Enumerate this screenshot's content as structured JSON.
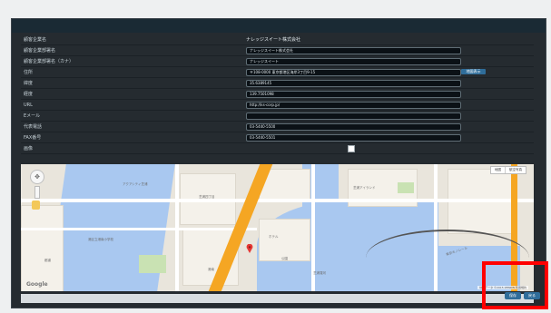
{
  "fields": [
    {
      "label": "顧客企業名",
      "value": "ナレッジスイート株式会社",
      "kind": "static"
    },
    {
      "label": "顧客企業部署名",
      "value": "ナレッジスイート株式会社",
      "kind": "input"
    },
    {
      "label": "顧客企業部署名（カナ）",
      "value": "ナレッジスイート",
      "kind": "input"
    },
    {
      "label": "住所",
      "value": "〒108-0000 東京都港区海岸3丁目9-15",
      "kind": "address",
      "button": "地図表示"
    },
    {
      "label": "緯度",
      "value": "35.6389145",
      "kind": "input"
    },
    {
      "label": "経度",
      "value": "139.7501098",
      "kind": "input"
    },
    {
      "label": "URL",
      "value": "http://ks-corp.jp/",
      "kind": "input"
    },
    {
      "label": "Eメール",
      "value": "",
      "kind": "input"
    },
    {
      "label": "代表電話",
      "value": "03-5440-5500",
      "kind": "input"
    },
    {
      "label": "FAX番号",
      "value": "03-5440-5501",
      "kind": "input"
    },
    {
      "label": "画像",
      "value": "",
      "kind": "checkbox"
    }
  ],
  "map": {
    "maptype": [
      "地図",
      "航空写真"
    ],
    "google": "Google",
    "terms": "地図データ ©2015 ZENRIN 利用規約",
    "labels": [
      "アクアシティ芝浦",
      "芝浦四丁目",
      "港区立港南小学校",
      "ホテル",
      "公園",
      "芝浦アイランド",
      "港南",
      "東京モノレール",
      "都道",
      "芝浦運河"
    ],
    "colors": {
      "water": "#a9c8f0",
      "road": "#ffffff",
      "highway": "#f5a623",
      "land": "#e9e5dc"
    }
  },
  "footer": {
    "save_label": "保存",
    "cancel_label": "戻る"
  },
  "colors": {
    "panel": "#252b30",
    "titlebar": "#1a2a34",
    "highlight": "#ff0000",
    "button": "#2f6d9a"
  }
}
